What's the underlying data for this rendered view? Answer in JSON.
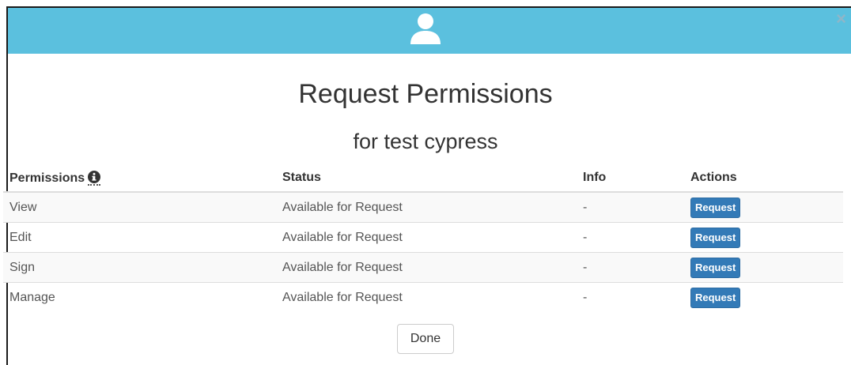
{
  "dialog": {
    "close_label": "×",
    "title": "Request Permissions",
    "subtitle": "for test cypress",
    "header_icon": "user-icon",
    "header_color": "#5bc0de"
  },
  "table": {
    "headers": {
      "permissions": "Permissions",
      "status": "Status",
      "info": "Info",
      "actions": "Actions"
    },
    "info_icon": "info-circle-icon",
    "rows": [
      {
        "permission": "View",
        "status": "Available for Request",
        "info": "-",
        "action": "Request"
      },
      {
        "permission": "Edit",
        "status": "Available for Request",
        "info": "-",
        "action": "Request"
      },
      {
        "permission": "Sign",
        "status": "Available for Request",
        "info": "-",
        "action": "Request"
      },
      {
        "permission": "Manage",
        "status": "Available for Request",
        "info": "-",
        "action": "Request"
      }
    ]
  },
  "footer": {
    "done_label": "Done"
  },
  "colors": {
    "primary_button": "#337ab7"
  }
}
